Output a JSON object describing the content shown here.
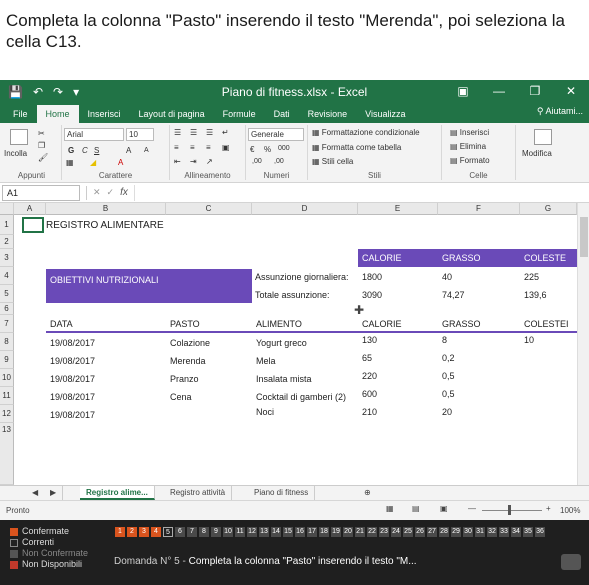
{
  "question": {
    "line1": "Completa la colonna \"Pasto\" inserendo il testo \"Merenda\", poi seleziona la",
    "line2": "cella C13."
  },
  "window": {
    "title": "Piano di fitness.xlsx  -  Excel",
    "undo_icon": "undo-icon",
    "redo_icon": "redo-icon",
    "save_icon": "save-icon"
  },
  "ribbon_tabs": [
    {
      "label": "File",
      "active": false
    },
    {
      "label": "Home",
      "active": true
    },
    {
      "label": "Inserisci",
      "active": false
    },
    {
      "label": "Layout di pagina",
      "active": false
    },
    {
      "label": "Formule",
      "active": false
    },
    {
      "label": "Dati",
      "active": false
    },
    {
      "label": "Revisione",
      "active": false
    },
    {
      "label": "Visualizza",
      "active": false
    }
  ],
  "help_label": "Aiutami...",
  "ribbon": {
    "paste_label": "Incolla",
    "clipboard_group": "Appunti",
    "font_name": "Arial",
    "font_size": "10",
    "bold": "G",
    "italic": "C",
    "underline": "S",
    "font_grow": "A",
    "font_shrink": "A",
    "font_group": "Carattere",
    "align_group": "Allineamento",
    "number_format": "Generale",
    "percent": "%",
    "thousands": "000",
    "dec_inc": ",00",
    "dec_dec": ",00",
    "number_group": "Numeri",
    "cond_format": "Formattazione condizionale",
    "format_table": "Formatta come tabella",
    "cell_styles": "Stili cella",
    "styles_group": "Stili",
    "insert": "Inserisci",
    "delete": "Elimina",
    "format": "Formato",
    "cells_group": "Celle",
    "modify": "Modifica"
  },
  "name_box": "A1",
  "fx": "fx",
  "columns": [
    "A",
    "B",
    "C",
    "D",
    "E",
    "F",
    "G"
  ],
  "rows": [
    "1",
    "2",
    "3",
    "4",
    "5",
    "6",
    "7",
    "8",
    "9",
    "10",
    "11",
    "12",
    "13"
  ],
  "cells": {
    "b1": "REGISTRO ALIMENTARE",
    "objectives": "OBIETTIVI NUTRIZIONALI",
    "goal_head": [
      "CALORIE",
      "GRASSO",
      "COLESTE"
    ],
    "intake_label": "Assunzione giornaliera:",
    "intake_values": [
      "1800",
      "40",
      "225"
    ],
    "total_label": "Totale assunzione:",
    "total_values": [
      "3090",
      "74,27",
      "139,6"
    ],
    "table_head": [
      "DATA",
      "PASTO",
      "ALIMENTO",
      "CALORIE",
      "GRASSO",
      "COLESTEI"
    ],
    "table_rows": [
      [
        "19/08/2017",
        "Colazione",
        "Yogurt greco",
        "130",
        "8",
        "10"
      ],
      [
        "19/08/2017",
        "Merenda",
        "Mela",
        "65",
        "0,2",
        ""
      ],
      [
        "19/08/2017",
        "Pranzo",
        "Insalata mista",
        "220",
        "0,5",
        ""
      ],
      [
        "19/08/2017",
        "Cena",
        "Cocktail di gamberi (2)",
        "600",
        "0,5",
        ""
      ],
      [
        "19/08/2017",
        "",
        "Noci",
        "210",
        "20",
        ""
      ]
    ]
  },
  "sheets": [
    "Registro alime...",
    "Registro attività",
    "Piano di fitness"
  ],
  "status": {
    "ready": "Pronto",
    "zoom": "100%"
  },
  "quiz": {
    "legend": [
      {
        "label": "Confermate",
        "color": "#d9541e"
      },
      {
        "label": "Correnti",
        "color": "#222222"
      },
      {
        "label": "Non Confermate",
        "color": "#555555"
      },
      {
        "label": "Non Disponibili",
        "color": "#c0392b"
      }
    ],
    "question_label": "Domanda N° 5 -",
    "question_text": "Completa la colonna \"Pasto\" inserendo il testo \"M..."
  }
}
